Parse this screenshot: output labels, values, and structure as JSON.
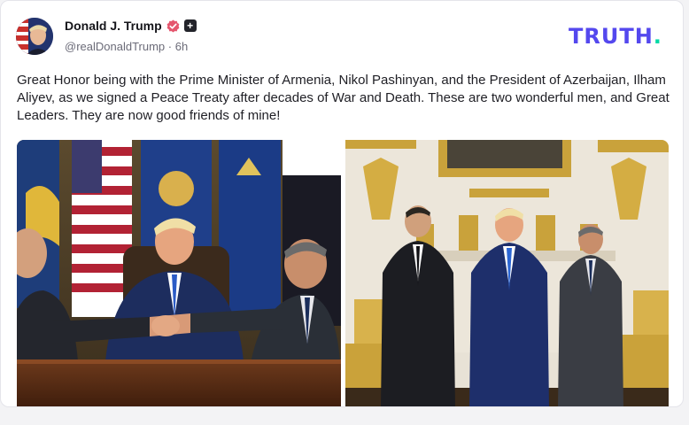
{
  "post": {
    "author_name": "Donald J. Trump",
    "handle": "@realDonaldTrump",
    "separator": "·",
    "time_ago": "6h",
    "body": "Great Honor being with the Prime Minister of Armenia, Nikol Pashinyan, and the President of Azerbaijan, Ilham Aliyev, as we signed a Peace Treaty after decades of War and Death. These are two wonderful men, and Great Leaders. They are now good friends of mine!",
    "plus_badge": "+",
    "verified_icon": "verified-badge-icon"
  },
  "brand": {
    "logo_text": "TRUTH",
    "logo_dot": ".",
    "accent": "#5448ee",
    "dot_color": "#00d9a6"
  },
  "media": {
    "images": [
      "handshake-photo",
      "oval-office-photo"
    ]
  }
}
